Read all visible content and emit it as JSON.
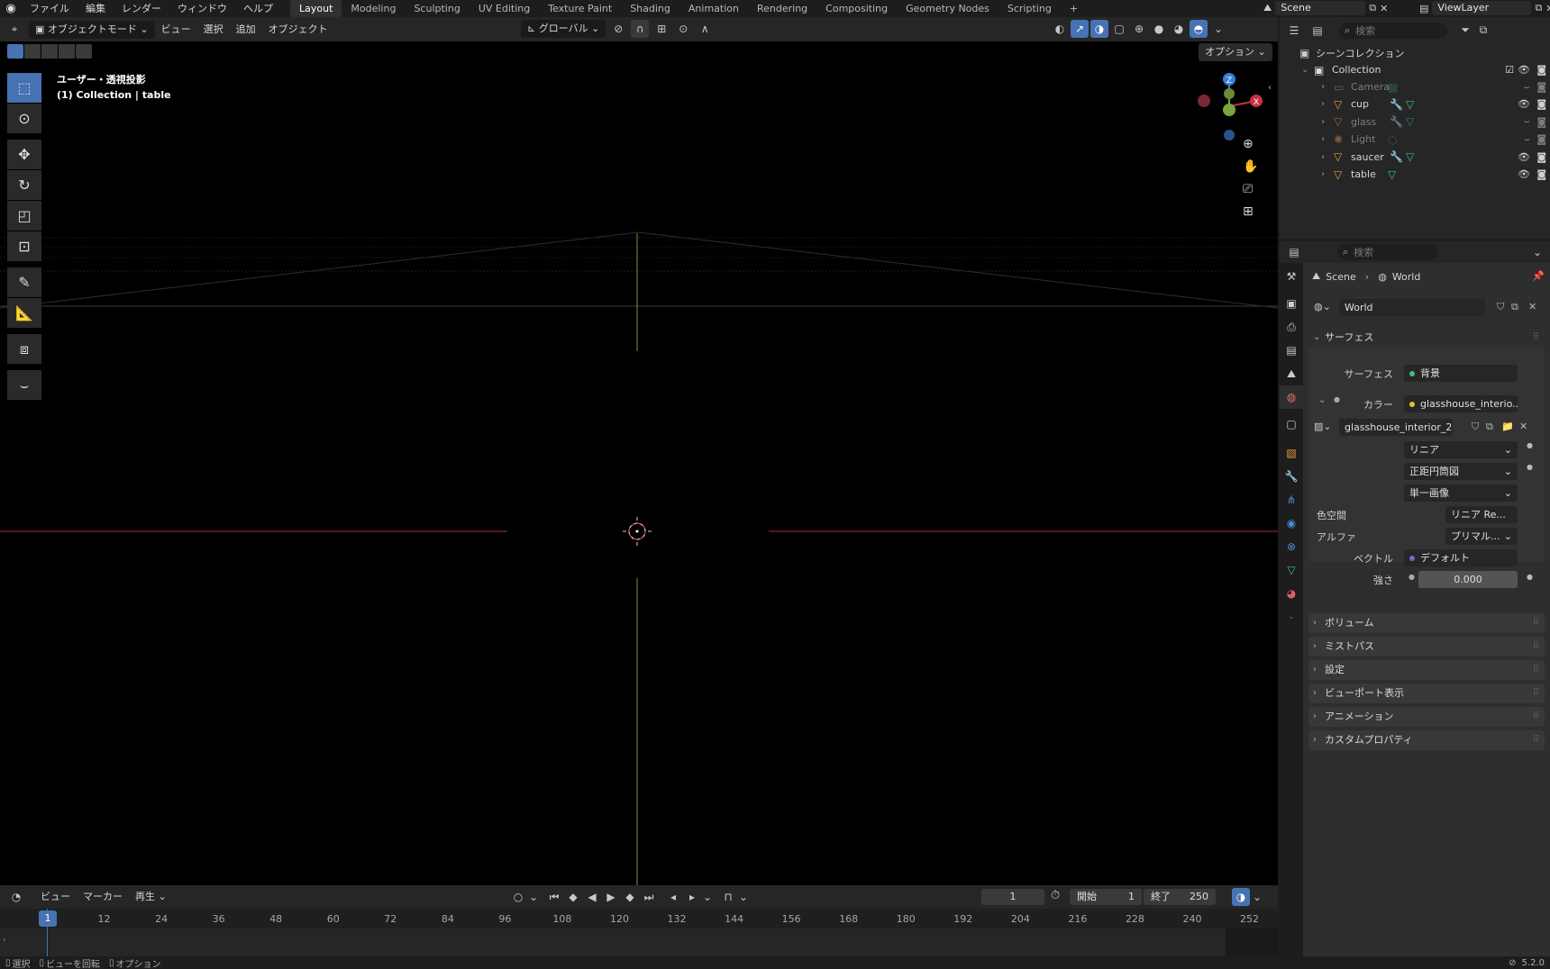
{
  "topbar": {
    "menus": [
      "ファイル",
      "編集",
      "レンダー",
      "ウィンドウ",
      "ヘルプ"
    ],
    "workspaces": [
      "Layout",
      "Modeling",
      "Sculpting",
      "UV Editing",
      "Texture Paint",
      "Shading",
      "Animation",
      "Rendering",
      "Compositing",
      "Geometry Nodes",
      "Scripting"
    ],
    "active_workspace": "Layout",
    "add_tab": "+",
    "scene": "Scene",
    "view_layer": "ViewLayer"
  },
  "viewport": {
    "mode": "オブジェクトモード",
    "menus": [
      "ビュー",
      "選択",
      "追加",
      "オブジェクト"
    ],
    "transform_orientation": "グローバル",
    "options": "オプション",
    "view_name": "ユーザー・透視投影",
    "view_context": "(1) Collection | table",
    "gizmo_z": "Z",
    "gizmo_x": "X"
  },
  "timeline": {
    "menus": [
      "ビュー",
      "マーカー",
      "再生"
    ],
    "current_frame": "1",
    "start_label": "開始",
    "start_frame": "1",
    "end_label": "終了",
    "end_frame": "250",
    "ticks": [
      "1",
      "12",
      "24",
      "36",
      "48",
      "60",
      "72",
      "84",
      "96",
      "108",
      "120",
      "132",
      "144",
      "156",
      "168",
      "180",
      "192",
      "204",
      "216",
      "228",
      "240",
      "252"
    ]
  },
  "statusbar": {
    "items": [
      "選択",
      "ビューを回転",
      "オプション"
    ],
    "version": "5.2.0"
  },
  "outliner": {
    "search_placeholder": "検索",
    "root": "シーンコレクション",
    "collection": "Collection",
    "items": [
      {
        "name": "Camera",
        "icon": "camera-icon",
        "color": "#c98a5a",
        "muted": true
      },
      {
        "name": "cup",
        "icon": "mesh-icon",
        "color": "#e89a3c",
        "muted": false
      },
      {
        "name": "glass",
        "icon": "mesh-icon",
        "color": "#e89a3c",
        "muted": true
      },
      {
        "name": "Light",
        "icon": "light-icon",
        "color": "#c98a5a",
        "muted": true
      },
      {
        "name": "saucer",
        "icon": "mesh-icon",
        "color": "#e89a3c",
        "muted": false
      },
      {
        "name": "table",
        "icon": "mesh-icon",
        "color": "#e89a3c",
        "muted": false
      }
    ]
  },
  "properties": {
    "search_placeholder": "検索",
    "breadcrumb_scene": "Scene",
    "breadcrumb_world": "World",
    "world_name": "World",
    "surface_panel": "サーフェス",
    "surface_label": "サーフェス",
    "surface_value": "背景",
    "color_label": "カラー",
    "color_value": "glasshouse_interio...",
    "image_name": "glasshouse_interior_2...",
    "interpolation": "リニア",
    "projection": "正距円筒図",
    "source": "単一画像",
    "colorspace_label": "色空間",
    "colorspace_value": "リニア Re...",
    "alpha_label": "アルファ",
    "alpha_value": "プリマル...",
    "vector_label": "ベクトル",
    "vector_value": "デフォルト",
    "strength_label": "強さ",
    "strength_value": "0.000",
    "collapsed_panels": [
      "ボリューム",
      "ミストパス",
      "設定",
      "ビューポート表示",
      "アニメーション",
      "カスタムプロパティ"
    ]
  },
  "colors": {
    "accent": "#4772b3",
    "x_axis": "#c83040",
    "y_axis": "#7aa43c",
    "z_axis": "#3a7fd8",
    "mesh": "#e89a3c"
  }
}
